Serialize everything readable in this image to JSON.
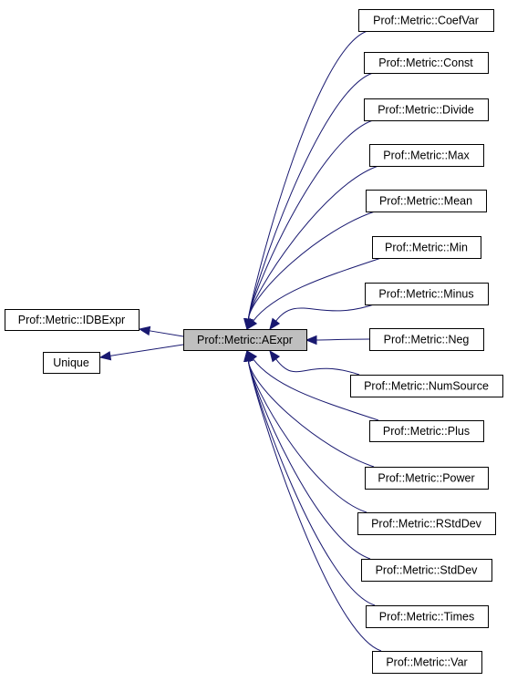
{
  "diagram": {
    "type": "inheritance-graph",
    "edge_color": "#191970",
    "current_node_fill": "#bfbfbf",
    "current": {
      "id": "aexpr",
      "label": "Prof::Metric::AExpr"
    },
    "bases": [
      {
        "id": "idbexpr",
        "label": "Prof::Metric::IDBExpr"
      },
      {
        "id": "unique",
        "label": "Unique"
      }
    ],
    "derived": [
      {
        "id": "coefvar",
        "label": "Prof::Metric::CoefVar"
      },
      {
        "id": "const",
        "label": "Prof::Metric::Const"
      },
      {
        "id": "divide",
        "label": "Prof::Metric::Divide"
      },
      {
        "id": "max",
        "label": "Prof::Metric::Max"
      },
      {
        "id": "mean",
        "label": "Prof::Metric::Mean"
      },
      {
        "id": "min",
        "label": "Prof::Metric::Min"
      },
      {
        "id": "minus",
        "label": "Prof::Metric::Minus"
      },
      {
        "id": "neg",
        "label": "Prof::Metric::Neg"
      },
      {
        "id": "numsource",
        "label": "Prof::Metric::NumSource"
      },
      {
        "id": "plus",
        "label": "Prof::Metric::Plus"
      },
      {
        "id": "power",
        "label": "Prof::Metric::Power"
      },
      {
        "id": "rstddev",
        "label": "Prof::Metric::RStdDev"
      },
      {
        "id": "stddev",
        "label": "Prof::Metric::StdDev"
      },
      {
        "id": "times",
        "label": "Prof::Metric::Times"
      },
      {
        "id": "var",
        "label": "Prof::Metric::Var"
      }
    ]
  }
}
